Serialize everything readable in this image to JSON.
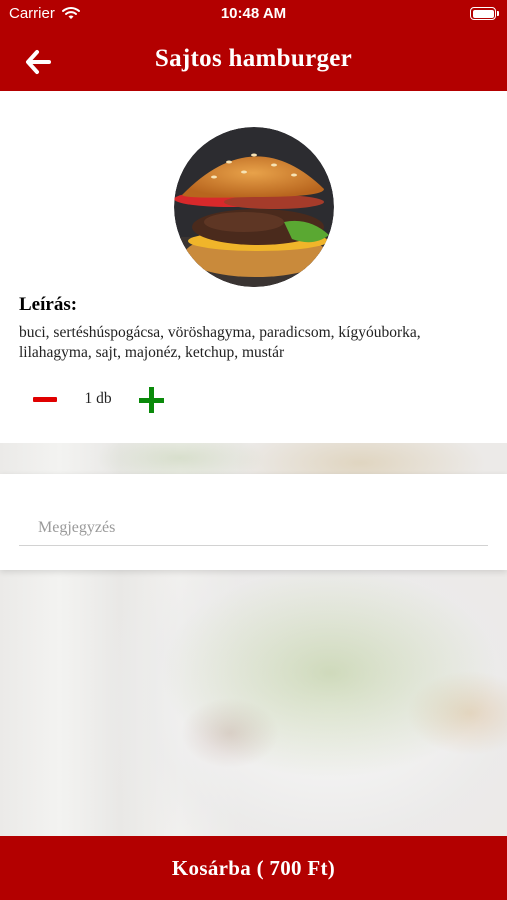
{
  "status_bar": {
    "carrier": "Carrier",
    "time": "10:48 AM"
  },
  "header": {
    "title": "Sajtos hamburger",
    "back_icon": "arrow-left-icon"
  },
  "product": {
    "image": "hamburger-photo",
    "description_title": "Leírás:",
    "description": "buci, sertéshúspogácsa, vöröshagyma, paradicsom, kígyóuborka, lilahagyma, sajt, majonéz, ketchup, mustár"
  },
  "quantity": {
    "value": "1 db",
    "minus_color": "#e00000",
    "plus_color": "#0a8a0a"
  },
  "note": {
    "placeholder": "Megjegyzés",
    "value": ""
  },
  "cart": {
    "label": "Kosárba ( 700 Ft)"
  },
  "colors": {
    "accent": "#b30000"
  }
}
